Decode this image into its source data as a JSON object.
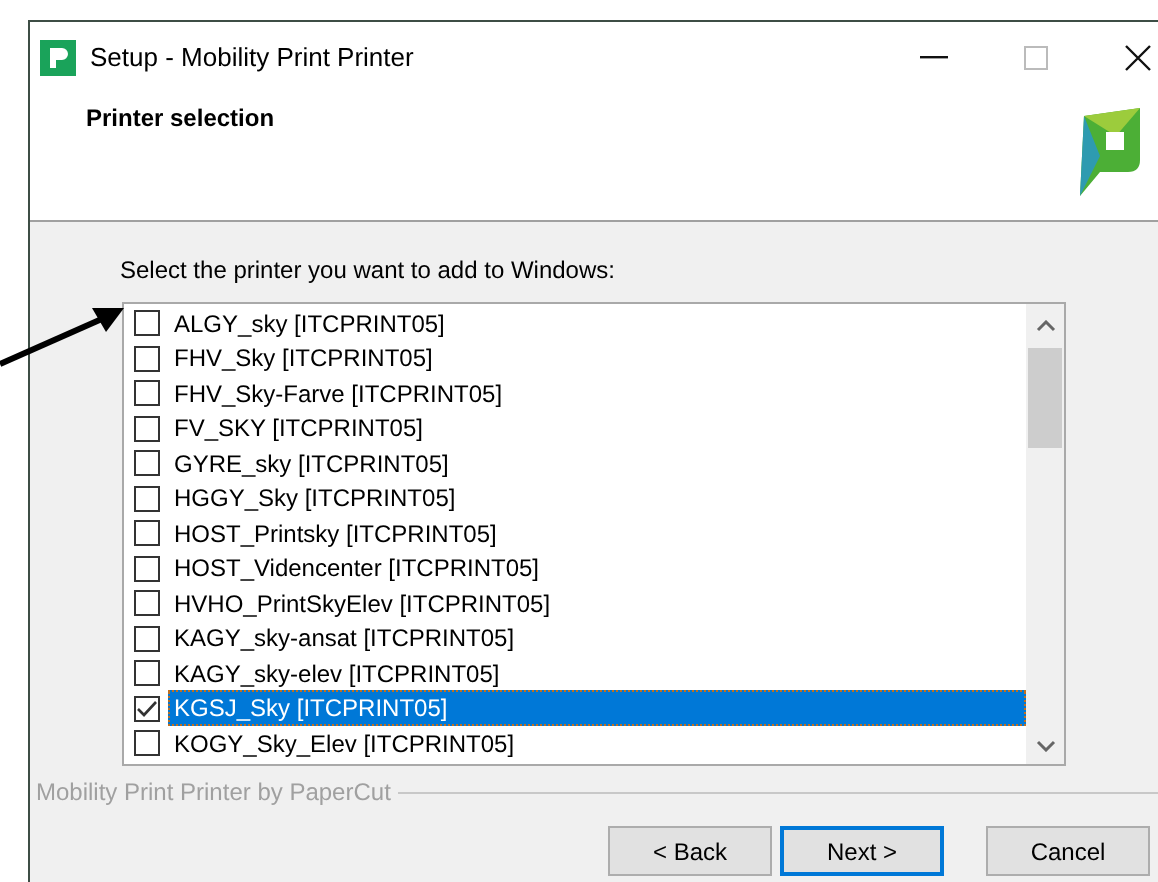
{
  "window": {
    "title": "Setup - Mobility Print Printer"
  },
  "header": {
    "title": "Printer selection"
  },
  "prompt": "Select the printer you want to add to Windows:",
  "printers": [
    {
      "label": "ALGY_sky [ITCPRINT05]",
      "checked": false,
      "selected": false
    },
    {
      "label": "FHV_Sky [ITCPRINT05]",
      "checked": false,
      "selected": false
    },
    {
      "label": "FHV_Sky-Farve [ITCPRINT05]",
      "checked": false,
      "selected": false
    },
    {
      "label": "FV_SKY [ITCPRINT05]",
      "checked": false,
      "selected": false
    },
    {
      "label": "GYRE_sky [ITCPRINT05]",
      "checked": false,
      "selected": false
    },
    {
      "label": "HGGY_Sky [ITCPRINT05]",
      "checked": false,
      "selected": false
    },
    {
      "label": "HOST_Printsky [ITCPRINT05]",
      "checked": false,
      "selected": false
    },
    {
      "label": "HOST_Videncenter [ITCPRINT05]",
      "checked": false,
      "selected": false
    },
    {
      "label": "HVHO_PrintSkyElev [ITCPRINT05]",
      "checked": false,
      "selected": false
    },
    {
      "label": "KAGY_sky-ansat [ITCPRINT05]",
      "checked": false,
      "selected": false
    },
    {
      "label": "KAGY_sky-elev [ITCPRINT05]",
      "checked": false,
      "selected": false
    },
    {
      "label": "KGSJ_Sky [ITCPRINT05]",
      "checked": true,
      "selected": true
    },
    {
      "label": "KOGY_Sky_Elev [ITCPRINT05]",
      "checked": false,
      "selected": false
    }
  ],
  "footer_group": "Mobility Print Printer by PaperCut",
  "buttons": [
    {
      "label": "< Back",
      "default": false
    },
    {
      "label": "Next >",
      "default": true
    },
    {
      "label": "Cancel",
      "default": false
    }
  ]
}
